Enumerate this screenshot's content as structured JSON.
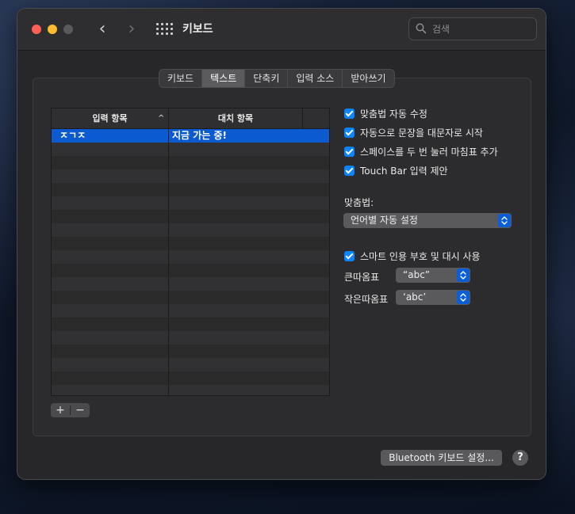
{
  "window": {
    "title": "키보드"
  },
  "search": {
    "placeholder": "검색"
  },
  "tabs": [
    {
      "label": "키보드",
      "active": false
    },
    {
      "label": "텍스트",
      "active": true
    },
    {
      "label": "단축키",
      "active": false
    },
    {
      "label": "입력 소스",
      "active": false
    },
    {
      "label": "받아쓰기",
      "active": false
    }
  ],
  "table": {
    "columns": [
      "입력 항목",
      "대치 항목"
    ],
    "rows": [
      {
        "replace": "ㅈㄱㅈ",
        "with": "지금 가는 중!",
        "selected": true
      }
    ]
  },
  "list_controls": {
    "add": "+",
    "remove": "−"
  },
  "options": {
    "checkboxes": [
      {
        "label": "맞춤법 자동 수정",
        "checked": true
      },
      {
        "label": "자동으로 문장을 대문자로 시작",
        "checked": true
      },
      {
        "label": "스페이스를 두 번 눌러 마침표 추가",
        "checked": true
      },
      {
        "label": "Touch Bar 입력 제안",
        "checked": true
      }
    ],
    "spelling_label": "맞춤법:",
    "spelling_value": "언어별 자동 설정",
    "smart_quotes": {
      "label": "스마트 인용 부호 및 대시 사용",
      "checked": true
    },
    "double_quotes_label": "큰따옴표",
    "double_quotes_value": "“abc”",
    "single_quotes_label": "작은따옴표",
    "single_quotes_value": "‘abc’"
  },
  "footer": {
    "bluetooth_button": "Bluetooth 키보드 설정...",
    "help": "?"
  },
  "colors": {
    "accent": "#0a84ff",
    "selection": "#0b5ad0"
  }
}
